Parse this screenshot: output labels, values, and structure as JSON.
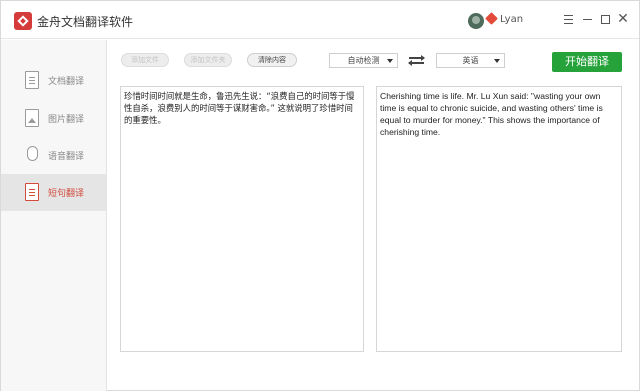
{
  "titlebar": {
    "app_title": "金舟文档翻译软件",
    "username": "Lyan",
    "close_glyph": "✕"
  },
  "sidebar": {
    "items": [
      {
        "label": "文档翻译",
        "icon": "document-icon",
        "active": false
      },
      {
        "label": "图片翻译",
        "icon": "image-icon",
        "active": false
      },
      {
        "label": "语音翻译",
        "icon": "microphone-icon",
        "active": false
      },
      {
        "label": "短句翻译",
        "icon": "text-document-icon",
        "active": true
      }
    ]
  },
  "toolbar": {
    "add_file_label": "添加文件",
    "add_folder_label": "添加文件夹",
    "clear_label": "清除内容",
    "source_language": "自动检测",
    "target_language": "英语",
    "translate_label": "开始翻译"
  },
  "panes": {
    "source_text": "珍惜时间时间就是生命，鲁迅先生说：“浪费自己的时间等于慢性自杀，浪费别人的时间等于谋财害命。” 这就说明了珍惜时间的重要性。",
    "translated_text": "Cherishing time is life. Mr. Lu Xun said: \"wasting your own time is equal to chronic suicide, and wasting others' time is equal to murder for money.\" This shows the importance of cherishing time."
  },
  "colors": {
    "accent": "#d14a3d",
    "primary_button": "#26a23a",
    "sidebar_bg": "#f7f7f7"
  }
}
